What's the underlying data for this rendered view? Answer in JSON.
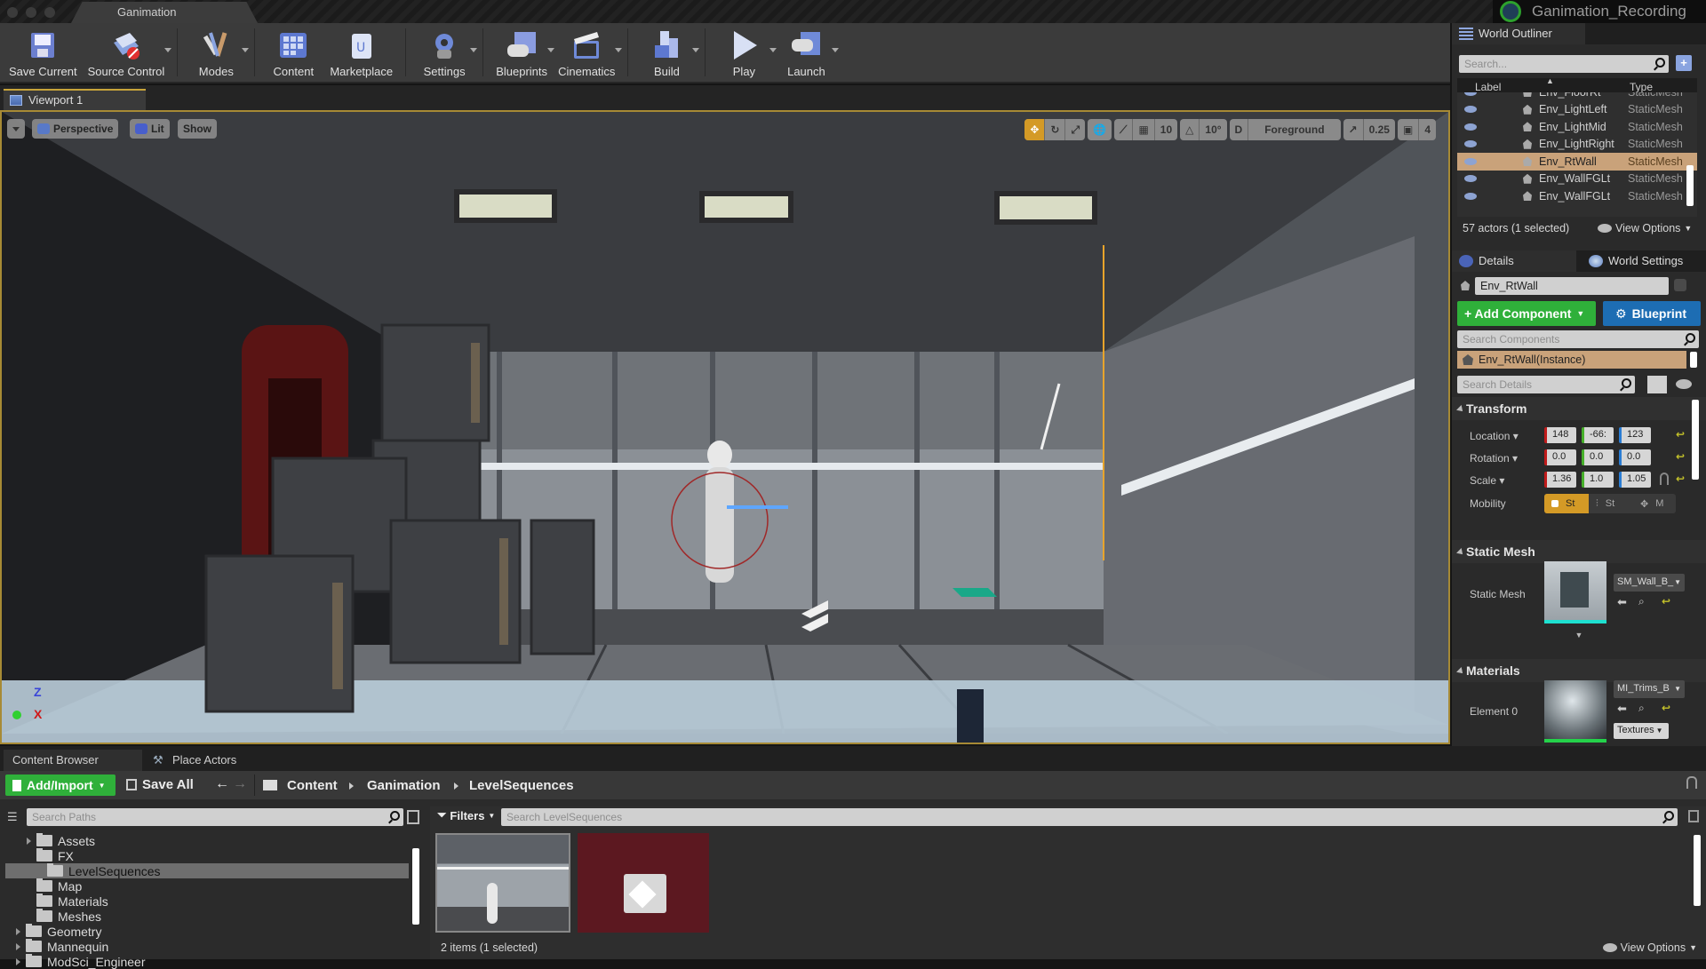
{
  "window": {
    "document_tab": "Ganimation",
    "project_title": "Ganimation_Recording"
  },
  "toolbar": {
    "buttons": [
      {
        "label": "Save Current",
        "icon": "save-icon",
        "has_dropdown": false
      },
      {
        "label": "Source Control",
        "icon": "source-control-icon",
        "has_dropdown": true
      },
      {
        "label": "Modes",
        "icon": "modes-icon",
        "has_dropdown": true
      },
      {
        "label": "Content",
        "icon": "content-icon",
        "has_dropdown": false
      },
      {
        "label": "Marketplace",
        "icon": "marketplace-icon",
        "has_dropdown": false
      },
      {
        "label": "Settings",
        "icon": "settings-icon",
        "has_dropdown": true
      },
      {
        "label": "Blueprints",
        "icon": "blueprints-icon",
        "has_dropdown": true
      },
      {
        "label": "Cinematics",
        "icon": "cinematics-icon",
        "has_dropdown": true
      },
      {
        "label": "Build",
        "icon": "build-icon",
        "has_dropdown": true
      },
      {
        "label": "Play",
        "icon": "play-icon",
        "has_dropdown": true
      },
      {
        "label": "Launch",
        "icon": "launch-icon",
        "has_dropdown": true
      }
    ]
  },
  "viewport": {
    "tab_label": "Viewport 1",
    "view_mode_buttons": {
      "perspective": "Perspective",
      "lit": "Lit",
      "show": "Show"
    },
    "grid_snap": "10",
    "rotation_snap": "10°",
    "layer": "Foreground",
    "scale_snap": "0.25",
    "camera_speed": "4",
    "axis_labels": {
      "z": "Z",
      "x": "X"
    }
  },
  "world_outliner": {
    "tab_label": "World Outliner",
    "search_placeholder": "Search...",
    "columns": {
      "label": "Label",
      "type": "Type"
    },
    "rows": [
      {
        "label": "Env_FloorRt",
        "type": "StaticMesh",
        "selected": false
      },
      {
        "label": "Env_LightLeft",
        "type": "StaticMesh",
        "selected": false
      },
      {
        "label": "Env_LightMid",
        "type": "StaticMesh",
        "selected": false
      },
      {
        "label": "Env_LightRight",
        "type": "StaticMesh",
        "selected": false
      },
      {
        "label": "Env_RtWall",
        "type": "StaticMesh",
        "selected": true
      },
      {
        "label": "Env_WallFGLt",
        "type": "StaticMesh",
        "selected": false
      },
      {
        "label": "Env_WallFGLt",
        "type": "StaticMesh",
        "selected": false
      }
    ],
    "status": "57 actors (1 selected)",
    "view_options": "View Options"
  },
  "details": {
    "tab_label": "Details",
    "world_settings_tab": "World Settings",
    "actor_name": "Env_RtWall",
    "add_component": "+ Add Component",
    "blueprint_button": "Blueprint",
    "search_components_placeholder": "Search Components",
    "component_instance": "Env_RtWall(Instance)",
    "search_details_placeholder": "Search Details",
    "transform": {
      "header": "Transform",
      "location_label": "Location",
      "location": [
        "148",
        "-66:",
        "123"
      ],
      "rotation_label": "Rotation",
      "rotation": [
        "0.0",
        "0.0",
        "0.0"
      ],
      "scale_label": "Scale",
      "scale": [
        "1.36",
        "1.0",
        "1.05"
      ],
      "mobility_label": "Mobility",
      "mobility_options": [
        "St",
        "St",
        "M"
      ],
      "mobility_selected": "St"
    },
    "static_mesh": {
      "header": "Static Mesh",
      "label": "Static Mesh",
      "asset": "SM_Wall_B_"
    },
    "materials": {
      "header": "Materials",
      "element_label": "Element 0",
      "asset": "MI_Trims_B",
      "textures_button": "Textures"
    }
  },
  "content_browser": {
    "tabs": [
      "Content Browser",
      "Place Actors"
    ],
    "add_import": "Add/Import",
    "save_all": "Save All",
    "breadcrumb": [
      "Content",
      "Ganimation",
      "LevelSequences"
    ],
    "search_paths_placeholder": "Search Paths",
    "filters": "Filters",
    "search_assets_placeholder": "Search LevelSequences",
    "folders": [
      {
        "name": "Assets",
        "depth": 2,
        "expandable": true,
        "selected": false
      },
      {
        "name": "FX",
        "depth": 2,
        "expandable": false,
        "selected": false
      },
      {
        "name": "LevelSequences",
        "depth": 2,
        "expandable": false,
        "selected": true
      },
      {
        "name": "Map",
        "depth": 2,
        "expandable": false,
        "selected": false
      },
      {
        "name": "Materials",
        "depth": 2,
        "expandable": false,
        "selected": false
      },
      {
        "name": "Meshes",
        "depth": 2,
        "expandable": false,
        "selected": false
      },
      {
        "name": "Geometry",
        "depth": 1,
        "expandable": true,
        "selected": false
      },
      {
        "name": "Mannequin",
        "depth": 1,
        "expandable": true,
        "selected": false
      },
      {
        "name": "ModSci_Engineer",
        "depth": 1,
        "expandable": true,
        "selected": false
      }
    ],
    "status": "2 items (1 selected)",
    "view_options": "View Options"
  }
}
